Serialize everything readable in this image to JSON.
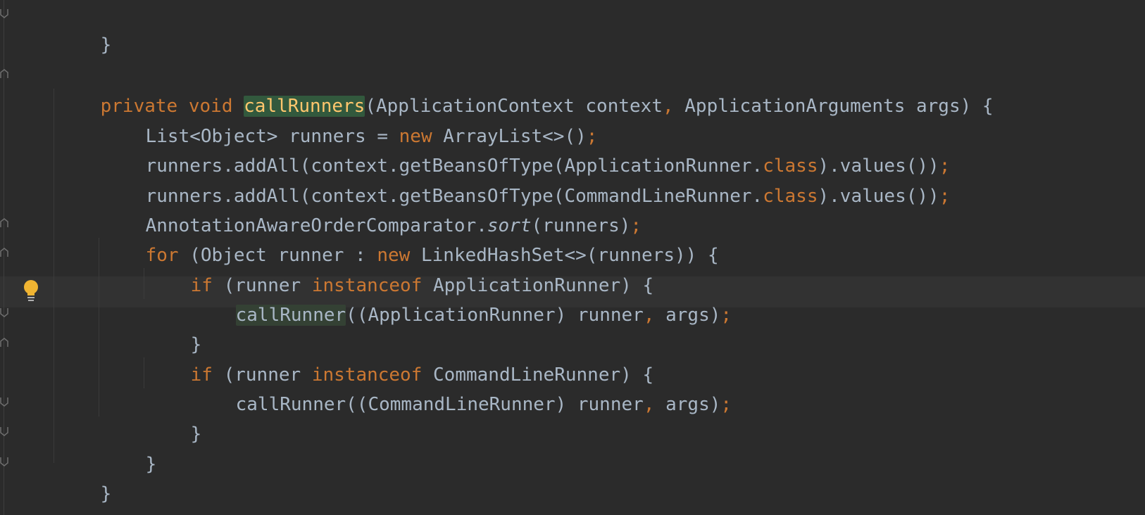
{
  "editor": {
    "lines": [
      [
        "}"
      ],
      [
        ""
      ],
      [
        "private",
        " ",
        "void",
        " ",
        "callRunners",
        "(ApplicationContext context",
        ",",
        " ApplicationArguments args) {"
      ],
      [
        "List<Object> runners = ",
        "new",
        " ArrayList<>()",
        ";"
      ],
      [
        "runners.addAll(context.getBeansOfType(ApplicationRunner.",
        "class",
        ").values())",
        ";"
      ],
      [
        "runners.addAll(context.getBeansOfType(CommandLineRunner.",
        "class",
        ").values())",
        ";"
      ],
      [
        "AnnotationAwareOrderComparator.",
        "sort",
        "(runners)",
        ";"
      ],
      [
        "for",
        " (Object runner : ",
        "new",
        " LinkedHashSet<>(runners)) {"
      ],
      [
        "if",
        " (runner ",
        "instanceof",
        " ApplicationRunner) {"
      ],
      [
        "callRunner",
        "((ApplicationRunner) runner",
        ",",
        " args)",
        ";"
      ],
      [
        "}"
      ],
      [
        "if",
        " (runner ",
        "instanceof",
        " CommandLineRunner) {"
      ],
      [
        "callRunner((CommandLineRunner) runner",
        ",",
        " args)",
        ";"
      ],
      [
        "}"
      ],
      [
        "}"
      ],
      [
        "}"
      ]
    ]
  },
  "icons": {
    "intention": "lightbulb-icon",
    "fold": "fold-marker-icon"
  },
  "colors": {
    "background": "#2b2b2b",
    "keyword": "#cc7832",
    "text": "#a9b7c6",
    "method_declaration": "#ffc66d",
    "declaration_highlight": "#32593d",
    "usage_highlight": "#344134",
    "current_line": "#323232",
    "bulb": "#f0b432"
  }
}
